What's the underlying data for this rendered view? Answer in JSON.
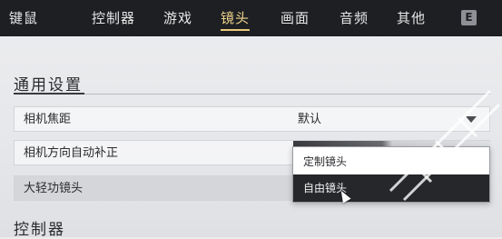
{
  "nav": {
    "tabs": [
      {
        "label": "键鼠"
      },
      {
        "label": "控制器"
      },
      {
        "label": "游戏"
      },
      {
        "label": "镜头",
        "active": true
      },
      {
        "label": "画面"
      },
      {
        "label": "音频"
      },
      {
        "label": "其他"
      }
    ],
    "key_hint": "E"
  },
  "sections": {
    "general": {
      "title": "通用设置"
    },
    "controller": {
      "title": "控制器"
    }
  },
  "settings": [
    {
      "label": "相机焦距",
      "value": "默认"
    },
    {
      "label": "相机方向自动补正",
      "value": ""
    },
    {
      "label": "大轻功镜头",
      "value": ""
    }
  ],
  "dropdown": {
    "options": [
      "定制镜头",
      "自由镜头"
    ],
    "selected_index": 1
  },
  "colors": {
    "nav_bg": "#1d1f23",
    "active_tab": "#f1d48c",
    "selected_option_bg": "#25272b"
  }
}
